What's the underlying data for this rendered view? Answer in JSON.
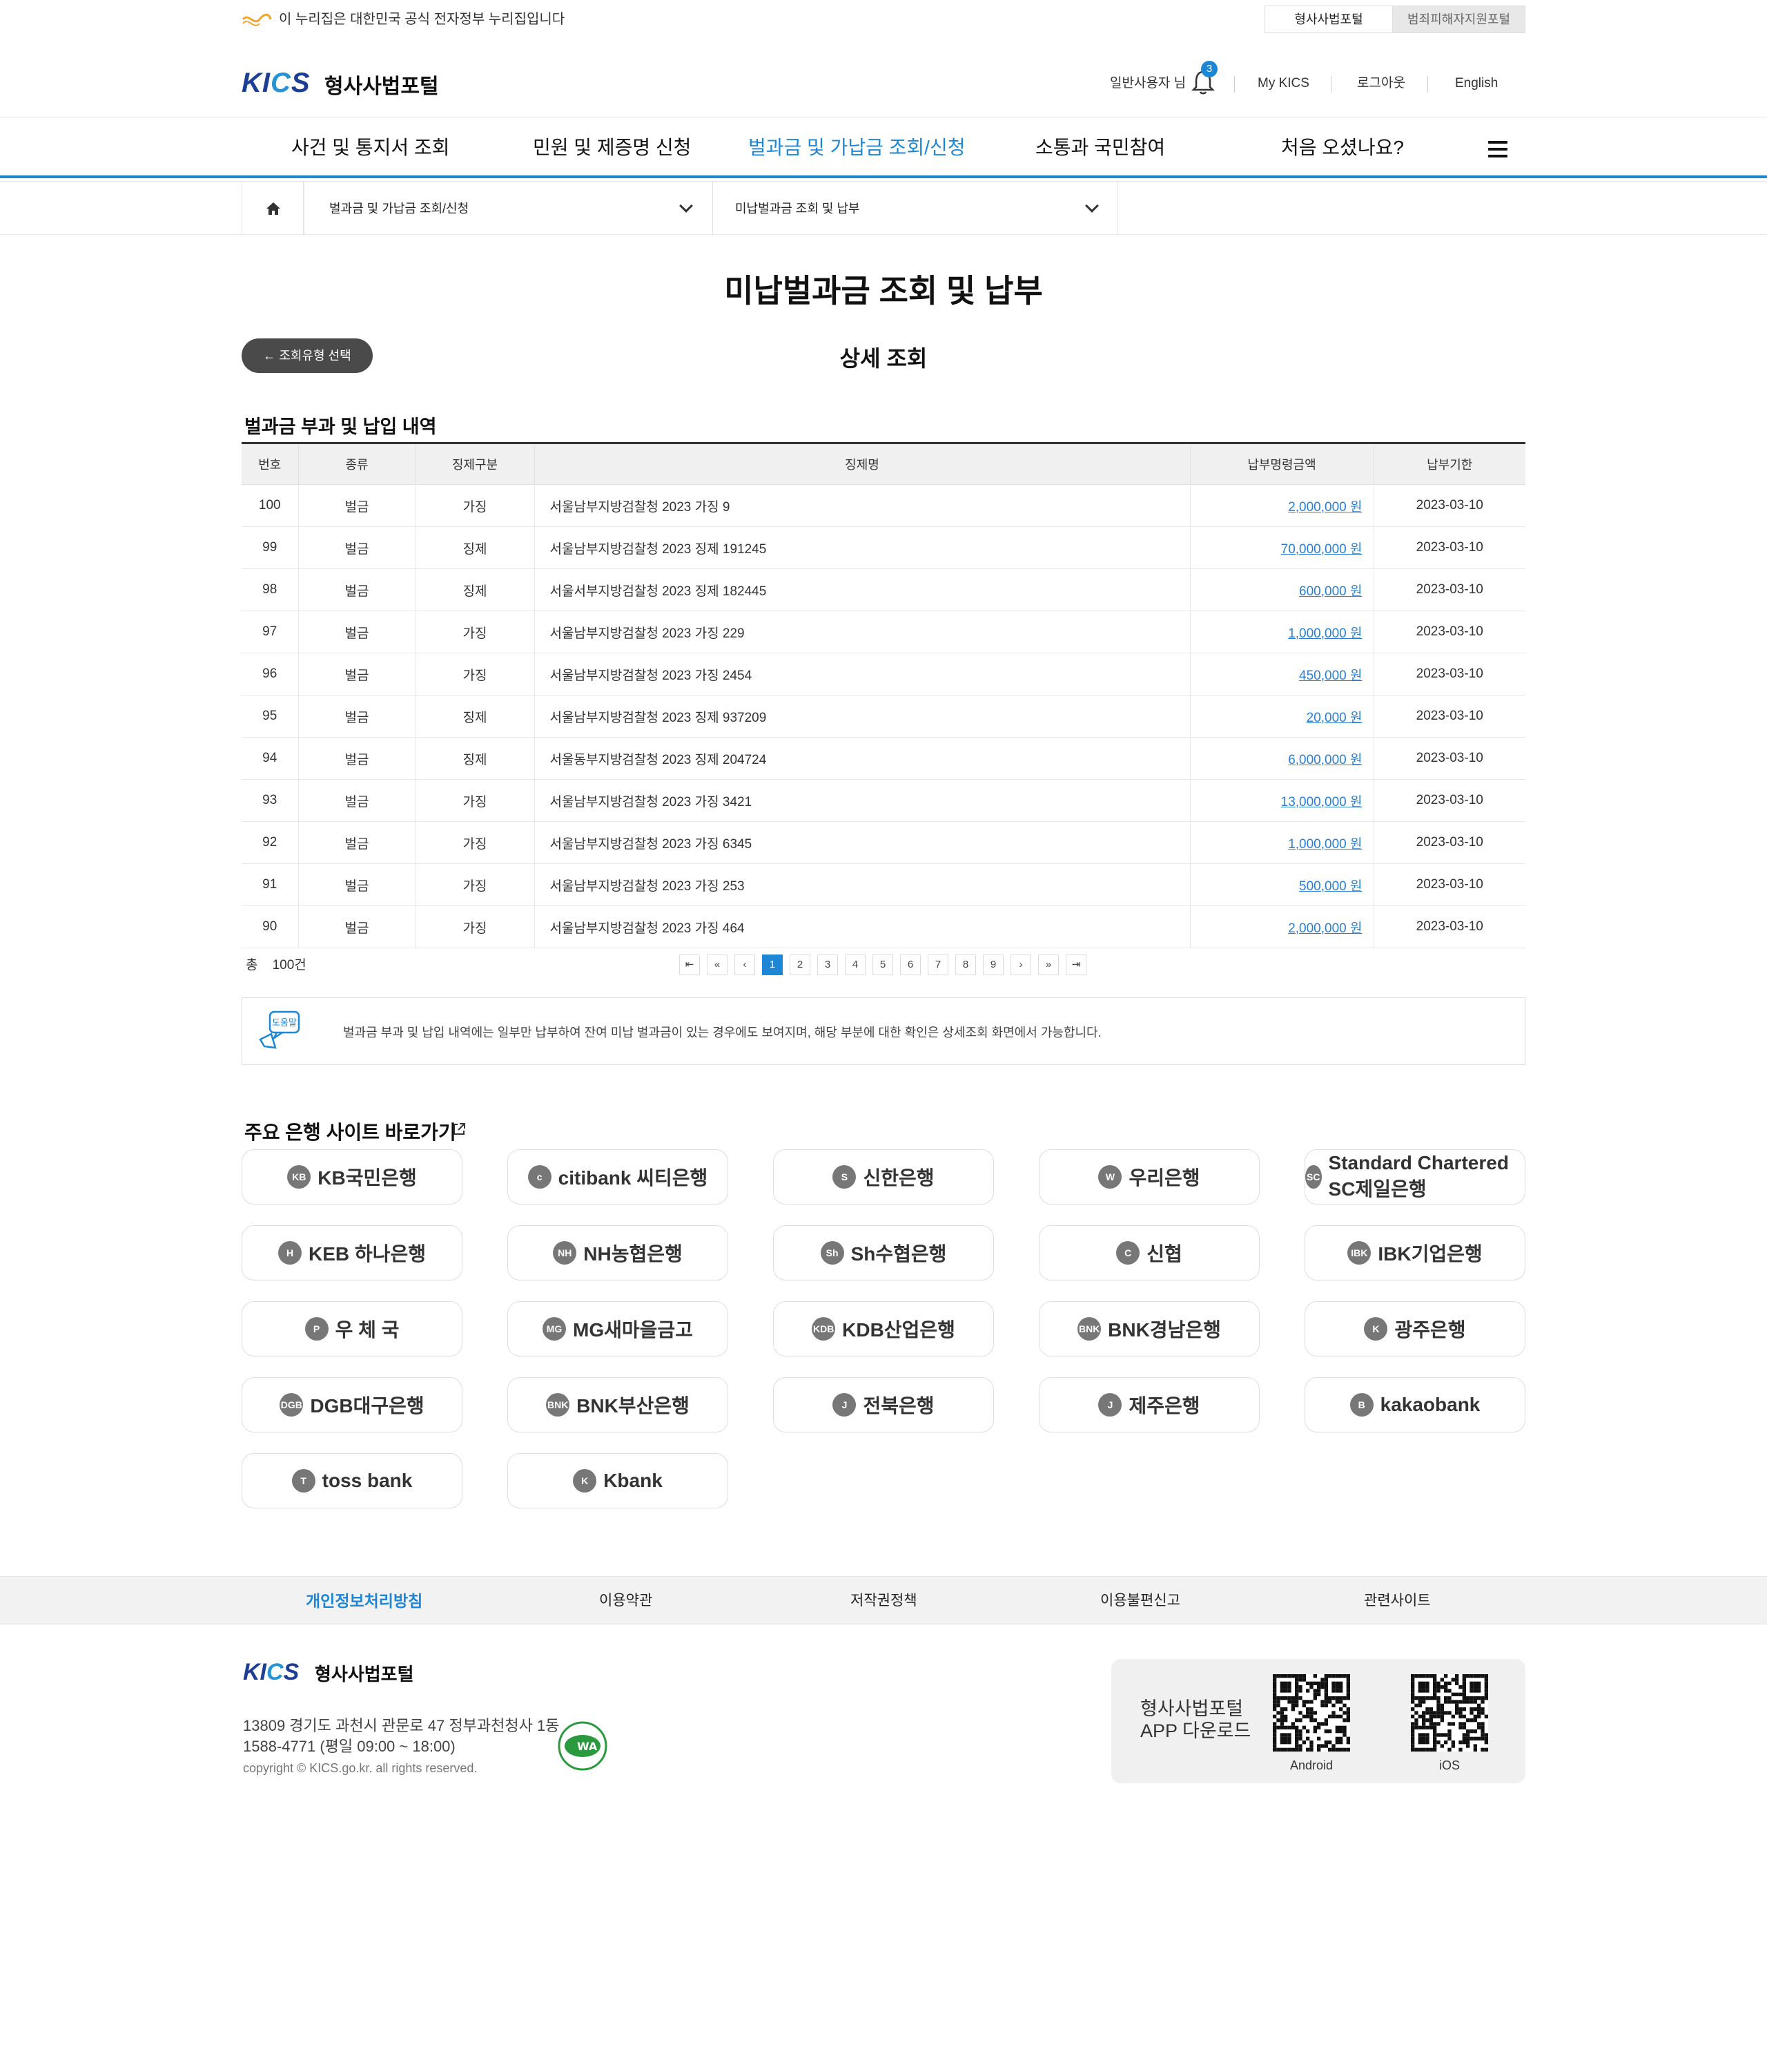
{
  "gov_strip": {
    "text": "이 누리집은 대한민국 공식 전자정부 누리집입니다",
    "tabs": [
      "형사사법포털",
      "범죄피해자지원포털"
    ]
  },
  "header": {
    "logo_text": "KICS",
    "logo_name": "형사사법포털",
    "user": "일반사용자 님",
    "notification_count": "3",
    "my_kics": "My KICS",
    "logout": "로그아웃",
    "english": "English"
  },
  "gnb": {
    "items": [
      "사건 및 통지서 조회",
      "민원 및 제증명 신청",
      "벌과금 및 가납금 조회/신청",
      "소통과 국민참여",
      "처음 오셨나요?"
    ]
  },
  "breadcrumb": {
    "level1": "벌과금 및 가납금 조회/신청",
    "level2": "미납벌과금 조회 및 납부"
  },
  "page": {
    "title": "미납벌과금 조회 및 납부",
    "back_button": "조회유형 선택",
    "subtitle": "상세 조회",
    "section_title": "벌과금 부과 및 납입 내역"
  },
  "table": {
    "headers": [
      "번호",
      "종류",
      "징제구분",
      "징제명",
      "납부명령금액",
      "납부기한"
    ],
    "rows": [
      [
        "100",
        "벌금",
        "가징",
        "서울남부지방검찰청 2023 가징 9",
        "2,000,000 원",
        "2023-03-10"
      ],
      [
        "99",
        "벌금",
        "징제",
        "서울남부지방검찰청 2023 징제 191245",
        "70,000,000 원",
        "2023-03-10"
      ],
      [
        "98",
        "벌금",
        "징제",
        "서울서부지방검찰청 2023 징제 182445",
        "600,000 원",
        "2023-03-10"
      ],
      [
        "97",
        "벌금",
        "가징",
        "서울남부지방검찰청 2023 가징 229",
        "1,000,000 원",
        "2023-03-10"
      ],
      [
        "96",
        "벌금",
        "가징",
        "서울남부지방검찰청 2023 가징 2454",
        "450,000 원",
        "2023-03-10"
      ],
      [
        "95",
        "벌금",
        "징제",
        "서울남부지방검찰청 2023 징제 937209",
        "20,000 원",
        "2023-03-10"
      ],
      [
        "94",
        "벌금",
        "징제",
        "서울동부지방검찰청 2023 징제 204724",
        "6,000,000 원",
        "2023-03-10"
      ],
      [
        "93",
        "벌금",
        "가징",
        "서울남부지방검찰청 2023 가징 3421",
        "13,000,000 원",
        "2023-03-10"
      ],
      [
        "92",
        "벌금",
        "가징",
        "서울남부지방검찰청 2023 가징 6345",
        "1,000,000 원",
        "2023-03-10"
      ],
      [
        "91",
        "벌금",
        "가징",
        "서울남부지방검찰청 2023 가징 253",
        "500,000 원",
        "2023-03-10"
      ],
      [
        "90",
        "벌금",
        "가징",
        "서울남부지방검찰청 2023 가징 464",
        "2,000,000 원",
        "2023-03-10"
      ]
    ]
  },
  "pagination": {
    "total_prefix": "총",
    "total_count": "100건",
    "first": "K",
    "prev_group": "«",
    "prev": "‹",
    "pages": [
      "1",
      "2",
      "3",
      "4",
      "5",
      "6",
      "7",
      "8",
      "9"
    ],
    "current": "1",
    "next": "›",
    "next_group": "»",
    "last": "K"
  },
  "help": {
    "icon_label": "도움말",
    "text": "벌과금 부과 및 납입 내역에는 일부만 납부하여 잔여 미납 벌과금이 있는 경우에도 보여지며, 해당 부분에 대한 확인은 상세조회 화면에서 가능합니다."
  },
  "banks": {
    "title": "주요 은행 사이트 바로가기",
    "items": [
      {
        "name": "KB국민은행",
        "mark": "KB"
      },
      {
        "name": "citibank 씨티은행",
        "mark": "c"
      },
      {
        "name": "신한은행",
        "mark": "S"
      },
      {
        "name": "우리은행",
        "mark": "W"
      },
      {
        "name": "Standard Chartered SC제일은행",
        "mark": "SC"
      },
      {
        "name": "KEB 하나은행",
        "mark": "H"
      },
      {
        "name": "NH농협은행",
        "mark": "NH"
      },
      {
        "name": "Sh수협은행",
        "mark": "Sh"
      },
      {
        "name": "신협",
        "mark": "C"
      },
      {
        "name": "IBK기업은행",
        "mark": "IBK"
      },
      {
        "name": "우 체 국",
        "mark": "P"
      },
      {
        "name": "MG새마을금고",
        "mark": "MG"
      },
      {
        "name": "KDB산업은행",
        "mark": "KDB"
      },
      {
        "name": "BNK경남은행",
        "mark": "BNK"
      },
      {
        "name": "광주은행",
        "mark": "K"
      },
      {
        "name": "DGB대구은행",
        "mark": "DGB"
      },
      {
        "name": "BNK부산은행",
        "mark": "BNK"
      },
      {
        "name": "전북은행",
        "mark": "J"
      },
      {
        "name": "제주은행",
        "mark": "J"
      },
      {
        "name": "kakaobank",
        "mark": "B"
      },
      {
        "name": "toss bank",
        "mark": "T"
      },
      {
        "name": "Kbank",
        "mark": "K"
      }
    ]
  },
  "footer": {
    "menu": [
      "개인정보처리방침",
      "이용약관",
      "저작권정책",
      "이용불편신고",
      "관련사이트"
    ],
    "logo_text": "KICS",
    "logo_name": "형사사법포털",
    "address": "13809  경기도 과천시 관문로 47 정부과천청사 1동",
    "phone": "1588-4771 (평일 09:00 ~ 18:00)",
    "copyright": "copyright © KICS.go.kr. all rights reserved.",
    "app_title_1": "형사사법포털",
    "app_title_2": "APP 다운로드",
    "android": "Android",
    "ios": "iOS"
  },
  "colors": {
    "accent": "#1d87d6",
    "brand_navy": "#1c3f95",
    "amount_link": "#2a7fd4"
  }
}
